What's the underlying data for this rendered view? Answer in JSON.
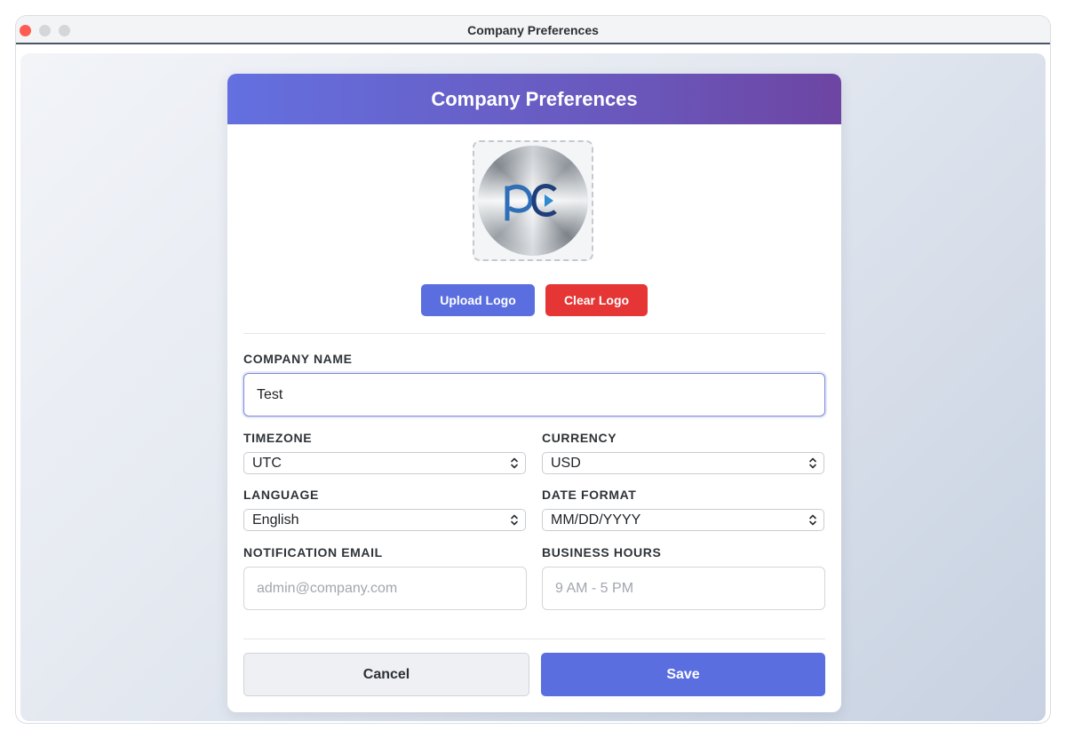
{
  "window": {
    "title": "Company Preferences"
  },
  "dialog": {
    "title": "Company Preferences",
    "logo": {
      "upload_label": "Upload Logo",
      "clear_label": "Clear Logo"
    },
    "company_name": {
      "label": "COMPANY NAME",
      "value": "Test"
    },
    "timezone": {
      "label": "TIMEZONE",
      "value": "UTC"
    },
    "currency": {
      "label": "CURRENCY",
      "value": "USD"
    },
    "language": {
      "label": "LANGUAGE",
      "value": "English"
    },
    "date_format": {
      "label": "DATE FORMAT",
      "value": "MM/DD/YYYY"
    },
    "notification_email": {
      "label": "NOTIFICATION EMAIL",
      "value": "",
      "placeholder": "admin@company.com"
    },
    "business_hours": {
      "label": "BUSINESS HOURS",
      "value": "",
      "placeholder": "9 AM - 5 PM"
    },
    "actions": {
      "cancel_label": "Cancel",
      "save_label": "Save"
    }
  },
  "colors": {
    "header_gradient_start": "#6470e0",
    "header_gradient_end": "#6d45a3",
    "primary": "#5b6ee0",
    "danger": "#e53535",
    "close_button": "#ff5b52"
  },
  "icons": {
    "window_controls": [
      "close-icon",
      "minimize-icon",
      "zoom-icon"
    ],
    "select_arrows": "chevron-up-down-icon",
    "logo": "company-logo"
  }
}
